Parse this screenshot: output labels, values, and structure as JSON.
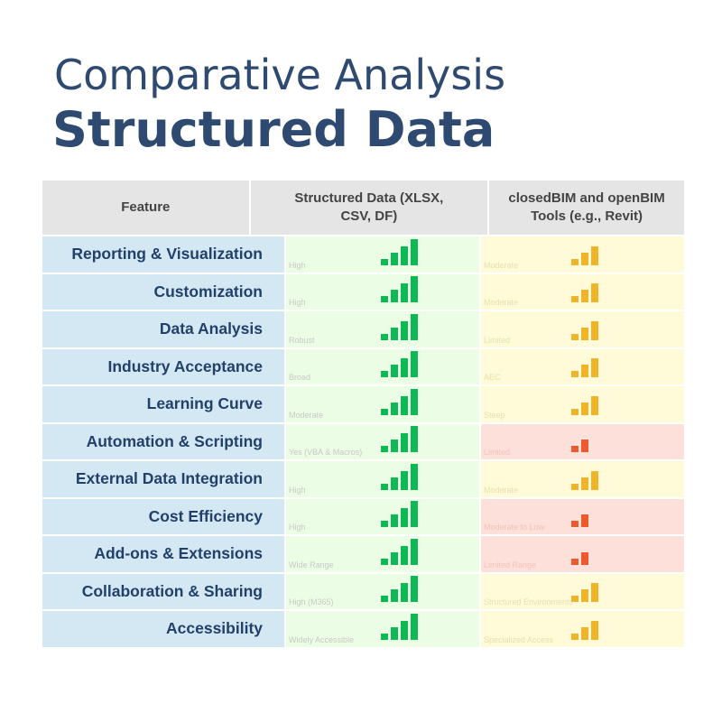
{
  "title": {
    "line1": "Comparative Analysis",
    "line2": "Structured Data"
  },
  "header": {
    "feature": "Feature",
    "col2": "Structured Data (XLSX, CSV, DF)",
    "col3": "closedBIM and openBIM Tools (e.g., Revit)"
  },
  "colors": {
    "green": "#0db955",
    "yellow": "#f0b429",
    "red": "#ee5a2d"
  },
  "rows": [
    {
      "feature": "Reporting & Visualization",
      "s_note": "High",
      "s_level": 4,
      "b_note": "Moderate",
      "b_level": 3
    },
    {
      "feature": "Customization",
      "s_note": "High",
      "s_level": 4,
      "b_note": "Moderate",
      "b_level": 3
    },
    {
      "feature": "Data Analysis",
      "s_note": "Robust",
      "s_level": 4,
      "b_note": "Limited",
      "b_level": 3
    },
    {
      "feature": "Industry Acceptance",
      "s_note": "Broad",
      "s_level": 4,
      "b_note": "AEC",
      "b_level": 3
    },
    {
      "feature": "Learning Curve",
      "s_note": "Moderate",
      "s_level": 4,
      "b_note": "Steep",
      "b_level": 3
    },
    {
      "feature": "Automation & Scripting",
      "s_note": "Yes (VBA & Macros)",
      "s_level": 4,
      "b_note": "Limited",
      "b_level": 2
    },
    {
      "feature": "External Data Integration",
      "s_note": "High",
      "s_level": 4,
      "b_note": "Moderate",
      "b_level": 3
    },
    {
      "feature": "Cost Efficiency",
      "s_note": "High",
      "s_level": 4,
      "b_note": "Moderate to Low",
      "b_level": 2
    },
    {
      "feature": "Add-ons & Extensions",
      "s_note": "Wide Range",
      "s_level": 4,
      "b_note": "Limited Range",
      "b_level": 2
    },
    {
      "feature": "Collaboration & Sharing",
      "s_note": "High (M365)",
      "s_level": 4,
      "b_note": "Structured Environments",
      "b_level": 3
    },
    {
      "feature": "Accessibility",
      "s_note": "Widely Accessible",
      "s_level": 4,
      "b_note": "Specialized Access",
      "b_level": 3
    }
  ]
}
